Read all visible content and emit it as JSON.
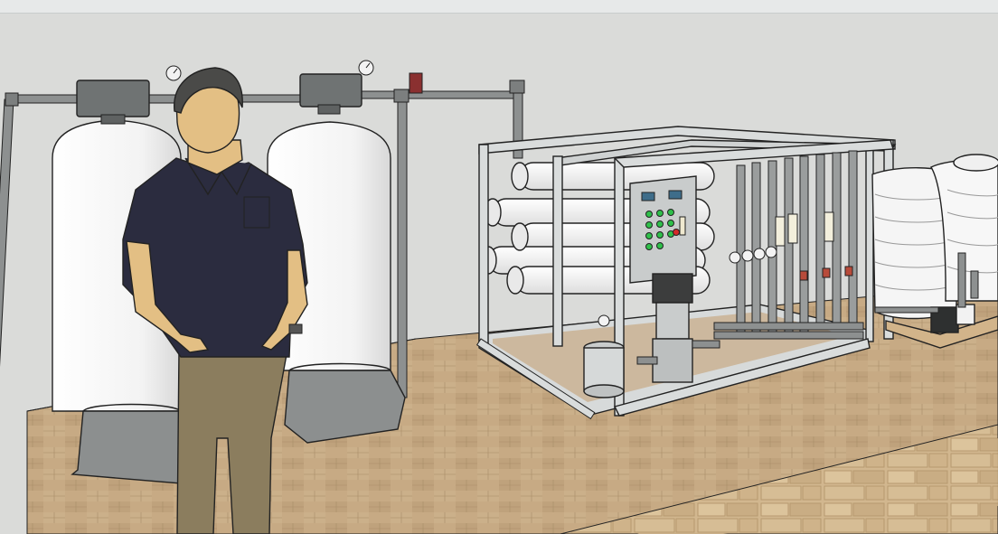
{
  "window": {
    "toolbar_present": true
  },
  "scene": {
    "subject": "reverse-osmosis-water-treatment-plant-model",
    "colors": {
      "background": "#dadbd9",
      "floor": "#c8ab86",
      "stone": "#cdb28a",
      "tank_white": "#f7f7f7",
      "pipe_gray": "#8f9292",
      "frame_steel": "#d9dcdc",
      "shirt_navy": "#2b2c3f",
      "pants_khaki": "#8b7d5e",
      "skin": "#e3bf84",
      "panel_steel": "#c9cccc",
      "button_green": "#2fbf4a",
      "button_red": "#d52a2a"
    },
    "icons": {
      "pressure_gauge": "gauge-icon",
      "valve": "valve-icon",
      "control_panel": "control-panel-icon"
    }
  }
}
